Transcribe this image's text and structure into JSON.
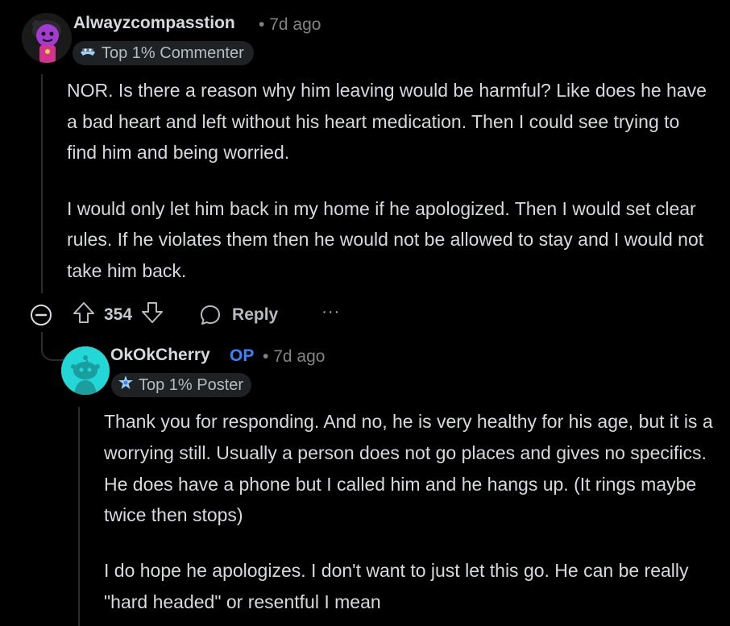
{
  "comments": [
    {
      "author": "Alwayzcompasstion",
      "separator": "•",
      "time": "7d ago",
      "badge": "Top 1% Commenter",
      "paragraphs": [
        "NOR. Is there a reason why him leaving would be harmful? Like does he have a bad heart and left without his heart medication. Then I could see trying to find him and being worried.",
        "I would only let him back in my home if he apologized. Then I would set clear rules. If he violates them then he would not be allowed to stay and I would not take him back."
      ],
      "score": "354",
      "reply_label": "Reply",
      "more_label": "···"
    },
    {
      "author": "OkOkCherry",
      "op_tag": "OP",
      "separator": "•",
      "time": "7d ago",
      "badge": "Top 1% Poster",
      "paragraphs": [
        "Thank you for responding. And no, he is very healthy for his age, but it is a worrying still. Usually a person does not go places and gives no specifics. He does have a phone but I called him and he hangs up. (It rings maybe twice then stops)",
        "I do hope he apologizes. I don't want to just let this go. He can be really \"hard headed\" or resentful I mean"
      ]
    }
  ],
  "icons": {
    "collapse": "collapse-minus-icon",
    "upvote": "upvote-arrow-icon",
    "downvote": "downvote-arrow-icon",
    "reply": "speech-bubble-icon",
    "badge_commenter": "commenter-badge-icon",
    "badge_poster": "poster-badge-icon"
  },
  "colors": {
    "background": "#000000",
    "text": "#d7dadc",
    "muted": "#818384",
    "op_blue": "#3a82ff",
    "badge_bg": "#1f2224",
    "avatar2_bg": "#24d7d7"
  }
}
